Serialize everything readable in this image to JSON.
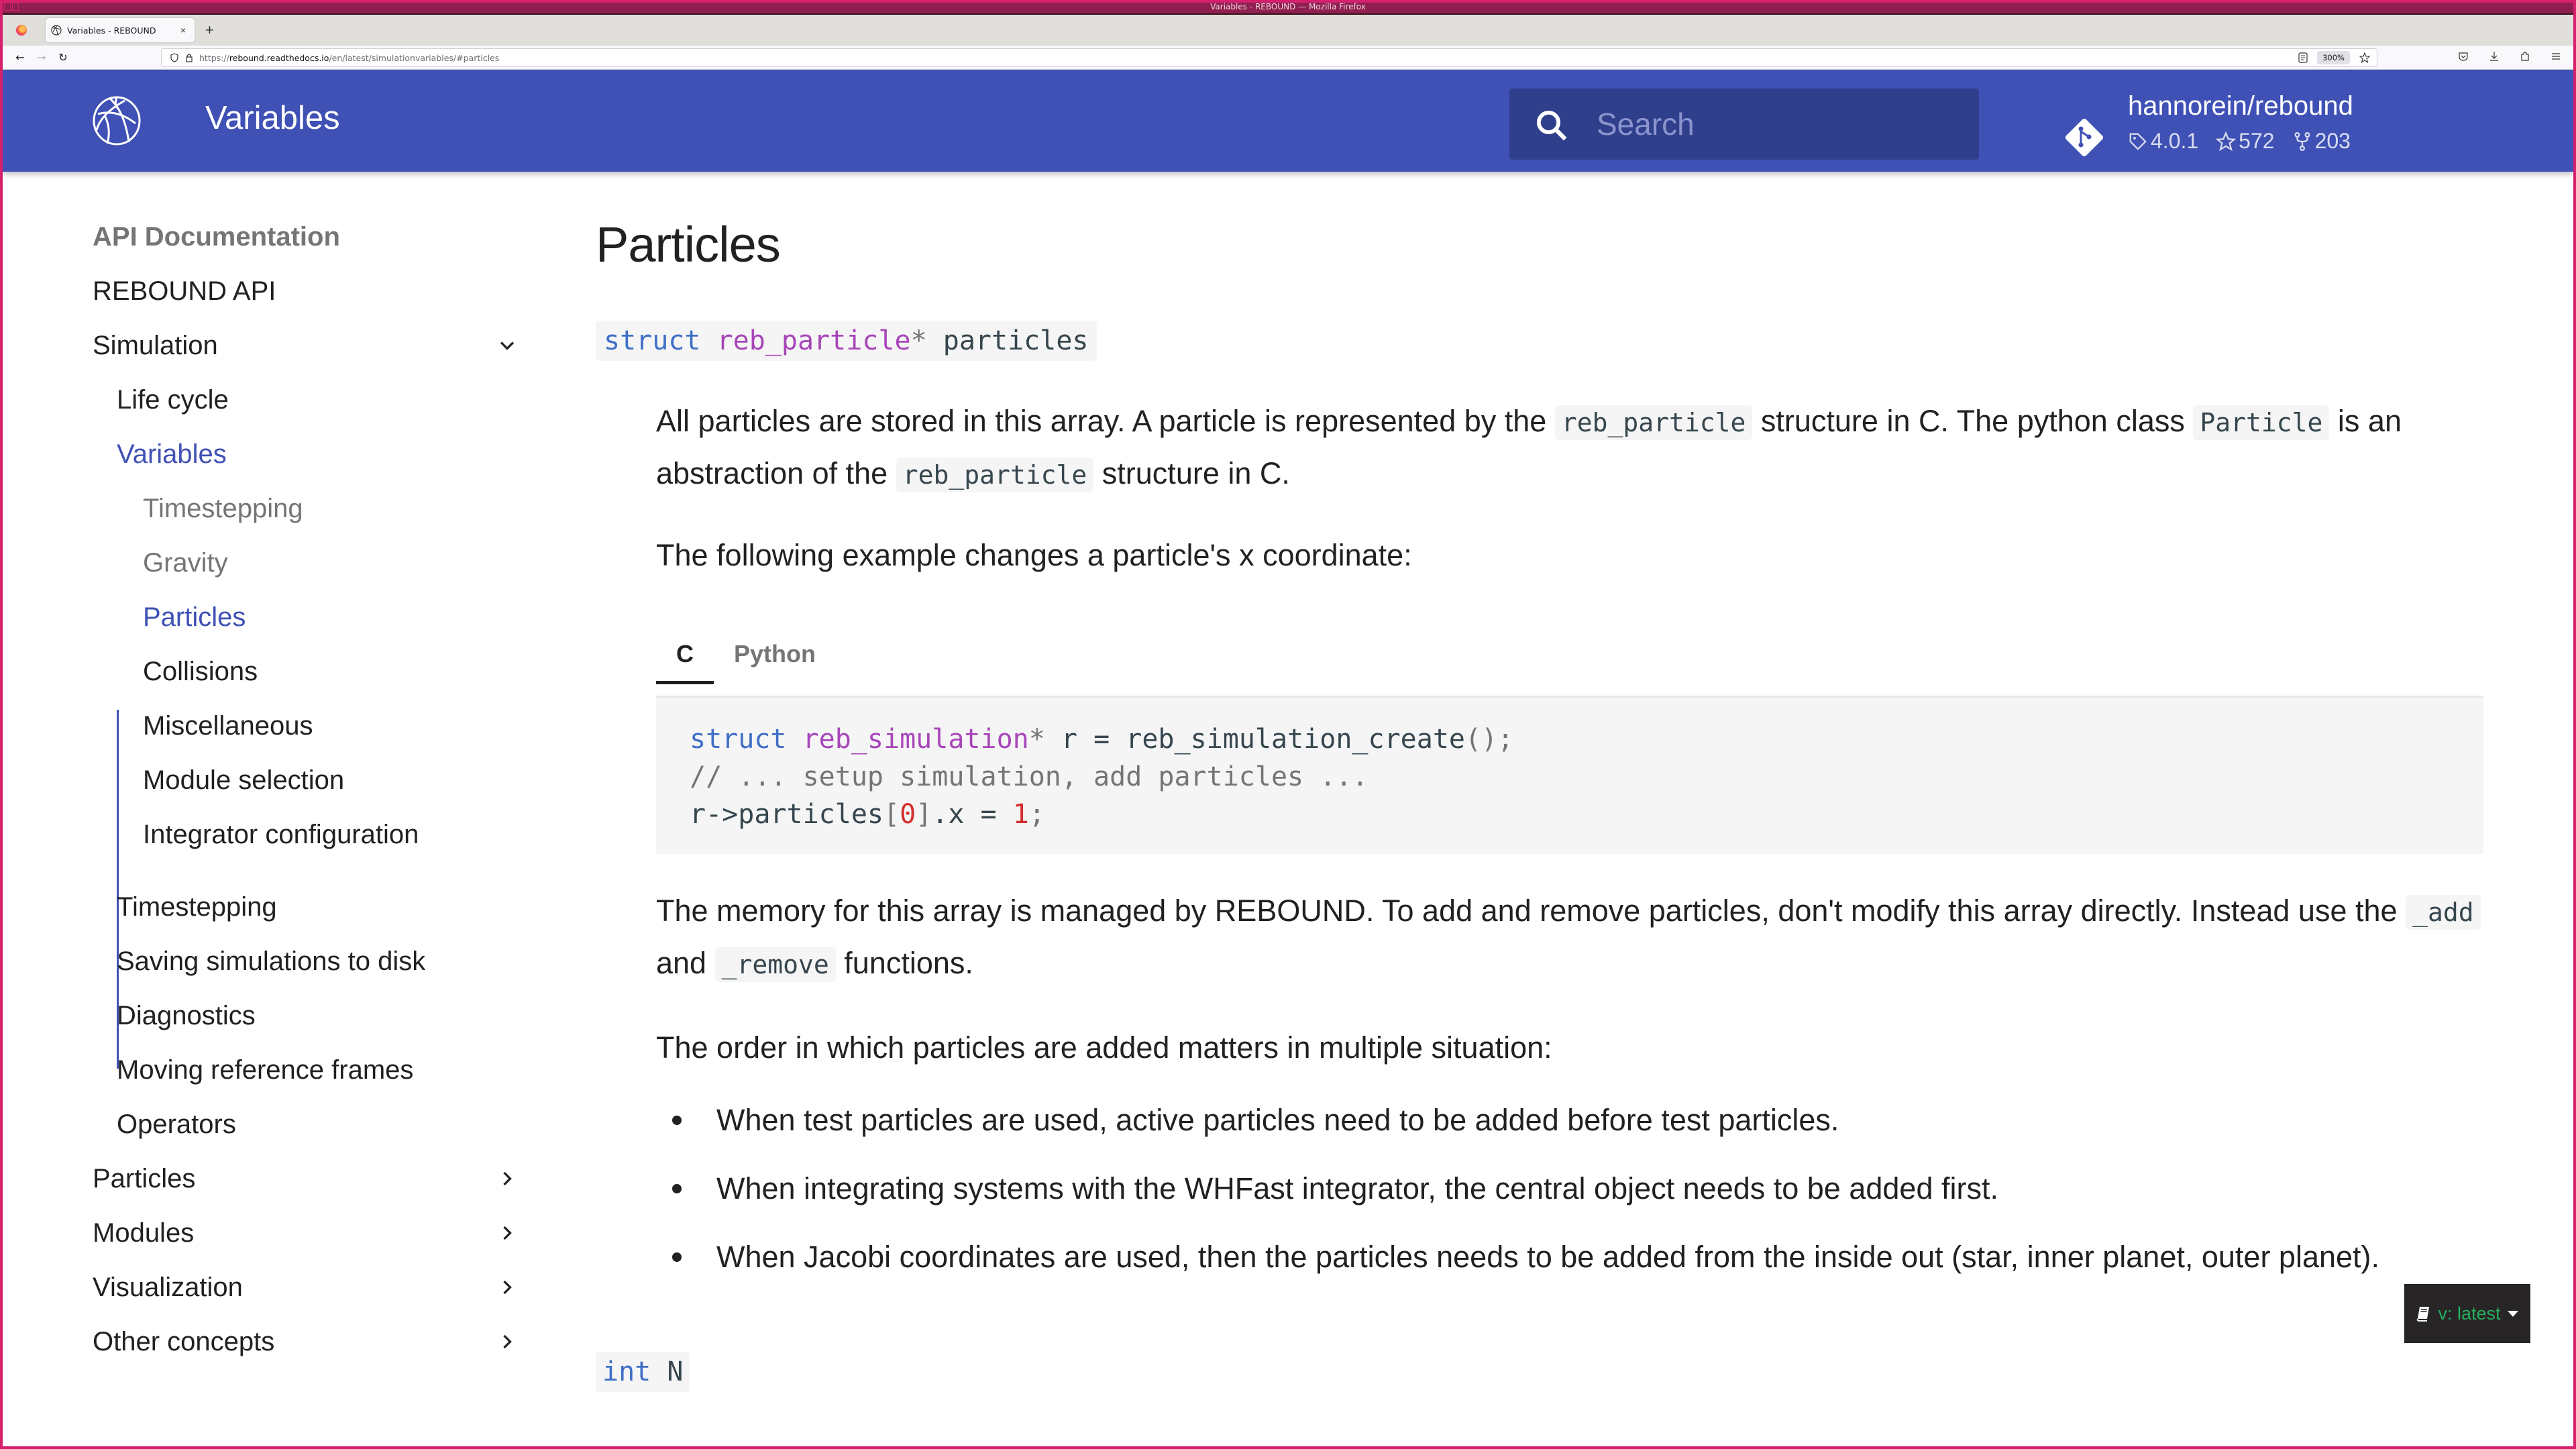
{
  "window": {
    "title": "Variables - REBOUND — Mozilla Firefox"
  },
  "browser": {
    "tab_title": "Variables - REBOUND",
    "tab_close": "×",
    "new_tab": "+",
    "url_prefix": "https://",
    "url_host": "rebound.readthedocs.io",
    "url_path": "/en/latest/simulationvariables/#particles",
    "zoom_level": "300%",
    "nav": {
      "back": "←",
      "forward": "→",
      "reload": "↻"
    }
  },
  "header": {
    "title": "Variables",
    "search_placeholder": "Search",
    "repo_name": "hannorein/rebound",
    "repo_version": "4.0.1",
    "repo_stars": "572",
    "repo_forks": "203",
    "brand_color": "#3f51b5"
  },
  "sidebar": {
    "caption": "API Documentation",
    "items": [
      {
        "label": "REBOUND API"
      },
      {
        "label": "Simulation",
        "expanded": true
      },
      {
        "label": "Life cycle"
      },
      {
        "label": "Variables",
        "active": true
      },
      {
        "label": "Timestepping"
      },
      {
        "label": "Gravity"
      },
      {
        "label": "Particles",
        "active": true
      },
      {
        "label": "Collisions"
      },
      {
        "label": "Miscellaneous"
      },
      {
        "label": "Module selection"
      },
      {
        "label": "Integrator configuration"
      },
      {
        "label": "Timestepping"
      },
      {
        "label": "Saving simulations to disk"
      },
      {
        "label": "Diagnostics"
      },
      {
        "label": "Moving reference frames"
      },
      {
        "label": "Operators"
      },
      {
        "label": "Particles",
        "expandable": true
      },
      {
        "label": "Modules",
        "expandable": true
      },
      {
        "label": "Visualization",
        "expandable": true
      },
      {
        "label": "Other concepts",
        "expandable": true
      }
    ]
  },
  "content": {
    "heading": "Particles",
    "signature": {
      "keyword": "struct",
      "type": "reb_particle",
      "pointer": "*",
      "name": "particles"
    },
    "para1": {
      "t1": "All particles are stored in this array. A particle is represented by the",
      "c1": "reb_particle",
      "t2": "structure in C. The python class",
      "c2": "Particle",
      "t3": "is an abstraction of the",
      "c3": "reb_particle",
      "t4": "structure in C."
    },
    "para2": "The following example changes a particle's x coordinate:",
    "code_tabs": [
      {
        "label": "C",
        "active": true
      },
      {
        "label": "Python"
      }
    ],
    "code": {
      "line1": {
        "kw": "struct",
        "ty": "reb_simulation",
        "op": "*",
        "rest": " r = reb_simulation_create",
        "paren": "()",
        "semi": ";"
      },
      "line2": "// ... setup simulation, add particles ...",
      "line3": {
        "a": "r->particles",
        "b1": "[",
        "idx": "0",
        "b2": "]",
        "c": ".x = ",
        "val": "1",
        "semi": ";"
      }
    },
    "para3": {
      "t1": "The memory for this array is managed by REBOUND. To add and remove particles, don't modify this array directly. Instead use the",
      "c1": "_add",
      "t2": "and",
      "c2": "_remove",
      "t3": "functions."
    },
    "para4": "The order in which particles are added matters in multiple situation:",
    "bullets": [
      "When test particles are used, active particles need to be added before test particles.",
      "When integrating systems with the WHFast integrator, the central object needs to be added first.",
      "When Jacobi coordinates are used, then the particles needs to be added from the inside out (star, inner planet, outer planet)."
    ],
    "signature2": {
      "keyword": "int",
      "name": "N"
    }
  },
  "rtd_badge": {
    "version": "v: latest",
    "accent": "#27ae60"
  }
}
